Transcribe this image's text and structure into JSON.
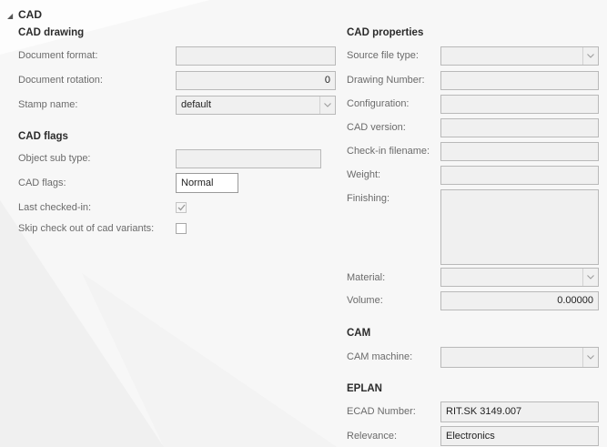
{
  "section": {
    "title": "CAD"
  },
  "cad_drawing": {
    "title": "CAD drawing",
    "document_format_label": "Document format:",
    "document_format_value": "",
    "document_rotation_label": "Document rotation:",
    "document_rotation_value": "0",
    "stamp_name_label": "Stamp name:",
    "stamp_name_value": "default"
  },
  "cad_flags": {
    "title": "CAD flags",
    "object_sub_type_label": "Object sub type:",
    "object_sub_type_value": "",
    "cad_flags_label": "CAD flags:",
    "cad_flags_value": "Normal",
    "last_checked_in_label": "Last checked-in:",
    "last_checked_in_checked": true,
    "skip_checkout_label": "Skip check out of cad variants:",
    "skip_checkout_checked": false
  },
  "cad_properties": {
    "title": "CAD properties",
    "source_file_type_label": "Source file type:",
    "source_file_type_value": "",
    "drawing_number_label": "Drawing Number:",
    "drawing_number_value": "",
    "configuration_label": "Configuration:",
    "configuration_value": "",
    "cad_version_label": "CAD version:",
    "cad_version_value": "",
    "checkin_filename_label": "Check-in filename:",
    "checkin_filename_value": "",
    "weight_label": "Weight:",
    "weight_value": "",
    "finishing_label": "Finishing:",
    "finishing_value": "",
    "material_label": "Material:",
    "material_value": "",
    "volume_label": "Volume:",
    "volume_value": "0.00000"
  },
  "cam": {
    "title": "CAM",
    "cam_machine_label": "CAM machine:",
    "cam_machine_value": ""
  },
  "eplan": {
    "title": "EPLAN",
    "ecad_number_label": "ECAD Number:",
    "ecad_number_value": "RIT.SK 3149.007",
    "relevance_label": "Relevance:",
    "relevance_value": "Electronics"
  }
}
